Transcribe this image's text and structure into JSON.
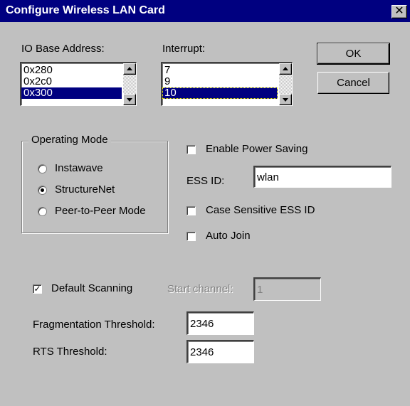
{
  "window": {
    "title": "Configure Wireless LAN Card",
    "close_glyph": "✕"
  },
  "io_base": {
    "label": "IO Base Address:",
    "items": [
      "0x280",
      "0x2c0",
      "0x300"
    ],
    "selected": "0x300"
  },
  "interrupt": {
    "label": "Interrupt:",
    "items": [
      "7",
      "9",
      "10"
    ],
    "selected": "10"
  },
  "buttons": {
    "ok": "OK",
    "cancel": "Cancel"
  },
  "operating_mode": {
    "title": "Operating Mode",
    "options": [
      "Instawave",
      "StructureNet",
      "Peer-to-Peer Mode"
    ],
    "selected": "StructureNet"
  },
  "enable_power_saving": {
    "label": "Enable Power Saving",
    "checked": false
  },
  "ess_id": {
    "label": "ESS ID:",
    "value": "wlan"
  },
  "case_sensitive": {
    "label": "Case Sensitive ESS ID",
    "checked": false
  },
  "auto_join": {
    "label": "Auto Join",
    "checked": false
  },
  "default_scanning": {
    "label": "Default Scanning",
    "checked": true,
    "check_glyph": "✓"
  },
  "start_channel": {
    "label": "Start channel:",
    "value": "1",
    "disabled": true
  },
  "fragmentation": {
    "label": "Fragmentation Threshold:",
    "value": "2346"
  },
  "rts": {
    "label": "RTS Threshold:",
    "value": "2346"
  },
  "colors": {
    "titlebar": "#000080",
    "dialog": "#c0c0c0",
    "selection": "#000080"
  }
}
